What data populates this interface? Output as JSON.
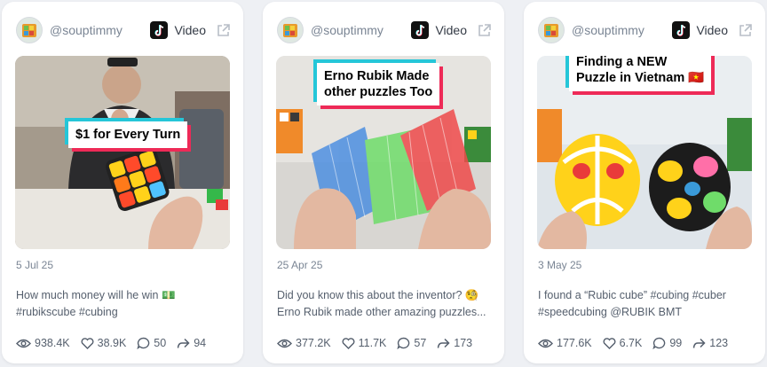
{
  "cards": [
    {
      "handle": "@souptimmy",
      "type_label": "Video",
      "thumb_caption": [
        "$1 for Every Turn"
      ],
      "date": "5 Jul 25",
      "desc": [
        "How much money will he win 💵",
        "#rubikscube #cubing"
      ],
      "stats": {
        "views": "938.4K",
        "likes": "38.9K",
        "comments": "50",
        "shares": "94"
      }
    },
    {
      "handle": "@souptimmy",
      "type_label": "Video",
      "thumb_caption": [
        "Erno Rubik Made",
        "other puzzles Too"
      ],
      "date": "25 Apr 25",
      "desc": [
        "Did you know this about the inventor? 🧐",
        "Erno Rubik made other amazing puzzles..."
      ],
      "stats": {
        "views": "377.2K",
        "likes": "11.7K",
        "comments": "57",
        "shares": "173"
      }
    },
    {
      "handle": "@souptimmy",
      "type_label": "Video",
      "thumb_caption": [
        "Finding a NEW",
        "Puzzle in Vietnam 🇻🇳"
      ],
      "date": "3 May 25",
      "desc": [
        "I found a “Rubic cube” #cubing #cuber",
        "#speedcubing @RUBIK BMT"
      ],
      "stats": {
        "views": "177.6K",
        "likes": "6.7K",
        "comments": "99",
        "shares": "123"
      }
    }
  ],
  "icons": {
    "platform": "tiktok-icon",
    "external": "external-link-icon",
    "views": "eye-icon",
    "likes": "heart-icon",
    "comments": "comment-icon",
    "shares": "share-icon"
  },
  "colors": {
    "caption_cyan": "#25c6d8",
    "caption_pink": "#ee2a57",
    "muted_text": "#7a8594",
    "body_text": "#555f6d"
  }
}
